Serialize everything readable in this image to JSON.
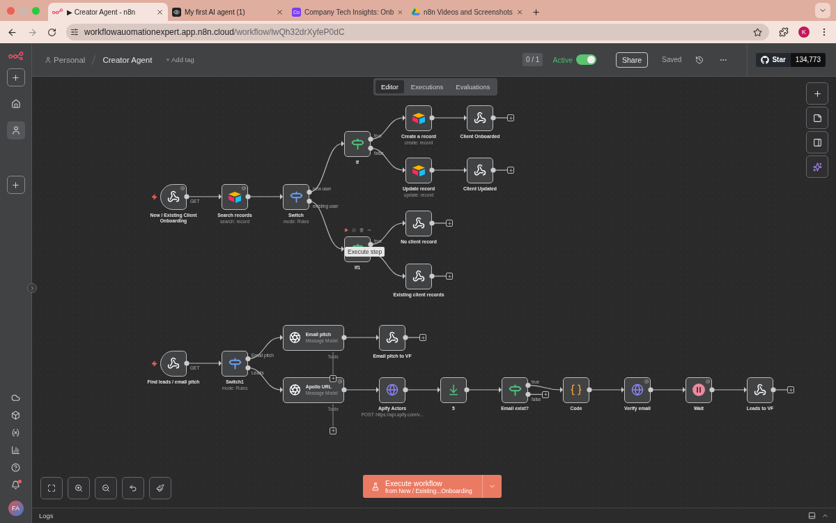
{
  "browser": {
    "tabs": [
      {
        "title": "▶ Creator Agent - n8n",
        "kind": "n8n",
        "selected": true
      },
      {
        "title": "My first AI agent (1)",
        "kind": "eye",
        "selected": false
      },
      {
        "title": "Company Tech Insights: Onb",
        "kind": "letters",
        "letters": "Co",
        "selected": false
      },
      {
        "title": "n8n Videos and Screenshots",
        "kind": "drive",
        "selected": false
      }
    ],
    "url": {
      "host": "workflowauomationexpert.app.n8n.cloud",
      "path": "/workflow/lwQh32drXyfeP0dC"
    },
    "profile": "K"
  },
  "sidebar": {
    "nav": [
      {
        "kind": "home",
        "selected": false
      },
      {
        "kind": "user",
        "selected": true
      }
    ],
    "notifications": true,
    "avatar": "FA"
  },
  "header": {
    "breadcrumb": [
      "Personal",
      "Creator Agent"
    ],
    "add_tag": "+ Add tag",
    "counter": "0 / 1",
    "active_label": "Active",
    "active": true,
    "share": "Share",
    "saved": "Saved",
    "github": {
      "label": "Star",
      "count": "134,773"
    }
  },
  "view_tabs": [
    {
      "label": "Editor",
      "selected": true
    },
    {
      "label": "Executions",
      "selected": false
    },
    {
      "label": "Evaluations",
      "selected": false
    }
  ],
  "nodes": [
    {
      "name": "New / Existing Client Onboarding",
      "kind": "trigger",
      "outputs": [
        "GET"
      ],
      "badge": true
    },
    {
      "name": "Search records",
      "subtitle": "search: record",
      "kind": "airtable",
      "badge": true
    },
    {
      "name": "Switch",
      "subtitle": "mode: Rules",
      "kind": "switch",
      "outputs": [
        "new user",
        "existing user"
      ]
    },
    {
      "name": "If",
      "kind": "if",
      "outputs": [
        "true",
        "false"
      ]
    },
    {
      "name": "Create a record",
      "subtitle": "create: record",
      "kind": "airtable"
    },
    {
      "name": "Client Onboarded",
      "kind": "webhook"
    },
    {
      "name": "Update record",
      "subtitle": "update: record",
      "kind": "airtable"
    },
    {
      "name": "Client Updated",
      "kind": "webhook"
    },
    {
      "name": "If1",
      "kind": "if",
      "outputs": [
        "true"
      ],
      "hovered": true,
      "tooltip": "Execute step"
    },
    {
      "name": "No client record",
      "kind": "webhook"
    },
    {
      "name": "Existing client records",
      "kind": "webhook"
    },
    {
      "name": "Find leads / email pitch",
      "kind": "trigger",
      "outputs": [
        "GET"
      ]
    },
    {
      "name": "Switch1",
      "subtitle": "mode: Rules",
      "kind": "switch",
      "outputs": [
        "Email pitch",
        "Leads"
      ]
    },
    {
      "name": "Email pitch",
      "subtitle": "Message Model",
      "kind": "llm",
      "tools": "Tools"
    },
    {
      "name": "Apollo URL",
      "subtitle": "Message Model",
      "kind": "llm",
      "tools": "Tools",
      "badge": true
    },
    {
      "name": "Email pitch to VF",
      "kind": "webhook"
    },
    {
      "name": "Apify Actors",
      "subtitle": "POST: https://api.apify.com/v...",
      "kind": "http"
    },
    {
      "name": "5",
      "kind": "extract"
    },
    {
      "name": "Email exist?",
      "kind": "if",
      "outputs": [
        "true",
        "false"
      ]
    },
    {
      "name": "Code",
      "kind": "code"
    },
    {
      "name": "Verify email",
      "kind": "http",
      "badge": true
    },
    {
      "name": "Wait",
      "kind": "wait",
      "badge": true
    },
    {
      "name": "Leads to VF",
      "kind": "webhook"
    }
  ],
  "execute": {
    "title": "Execute workflow",
    "subtitle": "from New / Existing...Onboarding"
  },
  "logs": {
    "title": "Logs"
  }
}
